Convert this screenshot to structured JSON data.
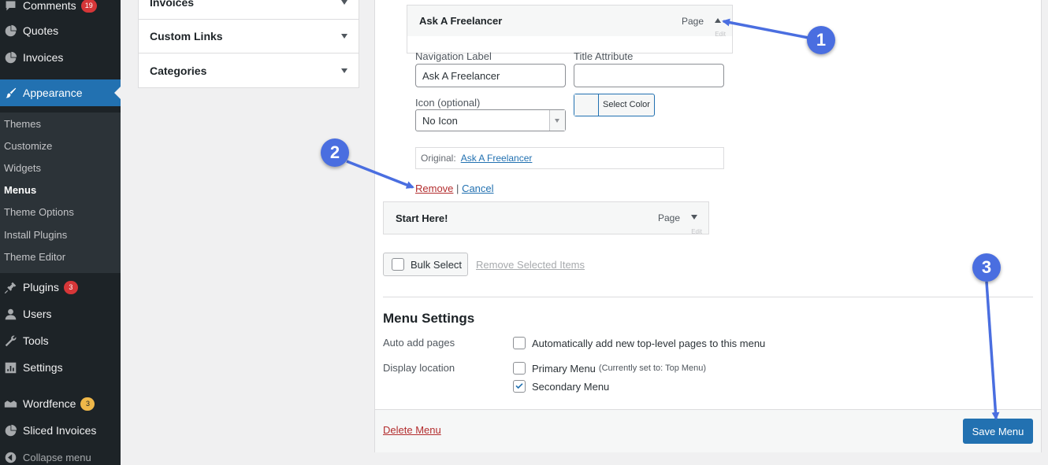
{
  "sidebar": {
    "items": [
      {
        "label": "Comments",
        "icon": "comments-icon",
        "badge": "19"
      },
      {
        "label": "Quotes",
        "icon": "quotes-icon"
      },
      {
        "label": "Invoices",
        "icon": "invoices-icon"
      },
      {
        "label": "Appearance",
        "icon": "paintbrush-icon"
      },
      {
        "label": "Plugins",
        "icon": "plugins-icon",
        "badge": "3"
      },
      {
        "label": "Users",
        "icon": "users-icon"
      },
      {
        "label": "Tools",
        "icon": "tools-icon"
      },
      {
        "label": "Settings",
        "icon": "settings-icon"
      },
      {
        "label": "Wordfence",
        "icon": "wordfence-icon",
        "badge": "3"
      },
      {
        "label": "Sliced Invoices",
        "icon": "sliced-invoices-icon"
      },
      {
        "label": "Collapse menu",
        "icon": "collapse-icon"
      }
    ],
    "appearance_submenu": [
      "Themes",
      "Customize",
      "Widgets",
      "Menus",
      "Theme Options",
      "Install Plugins",
      "Theme Editor"
    ],
    "current_submenu": "Menus"
  },
  "accordion": {
    "sections": [
      "Invoices",
      "Custom Links",
      "Categories"
    ]
  },
  "menu_item_open": {
    "title": "Ask A Freelancer",
    "type": "Page",
    "edit_label": "Edit",
    "nav_label_label": "Navigation Label",
    "nav_label_value": "Ask A Freelancer",
    "title_attr_label": "Title Attribute",
    "title_attr_value": "",
    "icon_label": "Icon (optional)",
    "icon_value": "No Icon",
    "color_button": "Select Color",
    "original_label": "Original:",
    "original_link": "Ask A Freelancer",
    "remove_label": "Remove",
    "separator": "|",
    "cancel_label": "Cancel"
  },
  "menu_item_closed": {
    "title": "Start Here!",
    "type": "Page",
    "edit_label": "Edit"
  },
  "bulk": {
    "bulk_select": "Bulk Select",
    "remove_selected": "Remove Selected Items"
  },
  "menu_settings": {
    "title": "Menu Settings",
    "auto_add_label": "Auto add pages",
    "auto_add_option": "Automatically add new top-level pages to this menu",
    "auto_add_checked": false,
    "display_location_label": "Display location",
    "primary_option": "Primary Menu",
    "primary_note": "(Currently set to: Top Menu)",
    "primary_checked": false,
    "secondary_option": "Secondary Menu",
    "secondary_checked": true
  },
  "footer": {
    "delete_menu": "Delete Menu",
    "save_menu": "Save Menu"
  },
  "annotations": {
    "callouts": [
      "1",
      "2",
      "3"
    ],
    "color": "#4a6ee0"
  },
  "colors": {
    "sidebar_bg": "#1d2327",
    "accent": "#2271b1",
    "danger": "#b32d2e"
  }
}
